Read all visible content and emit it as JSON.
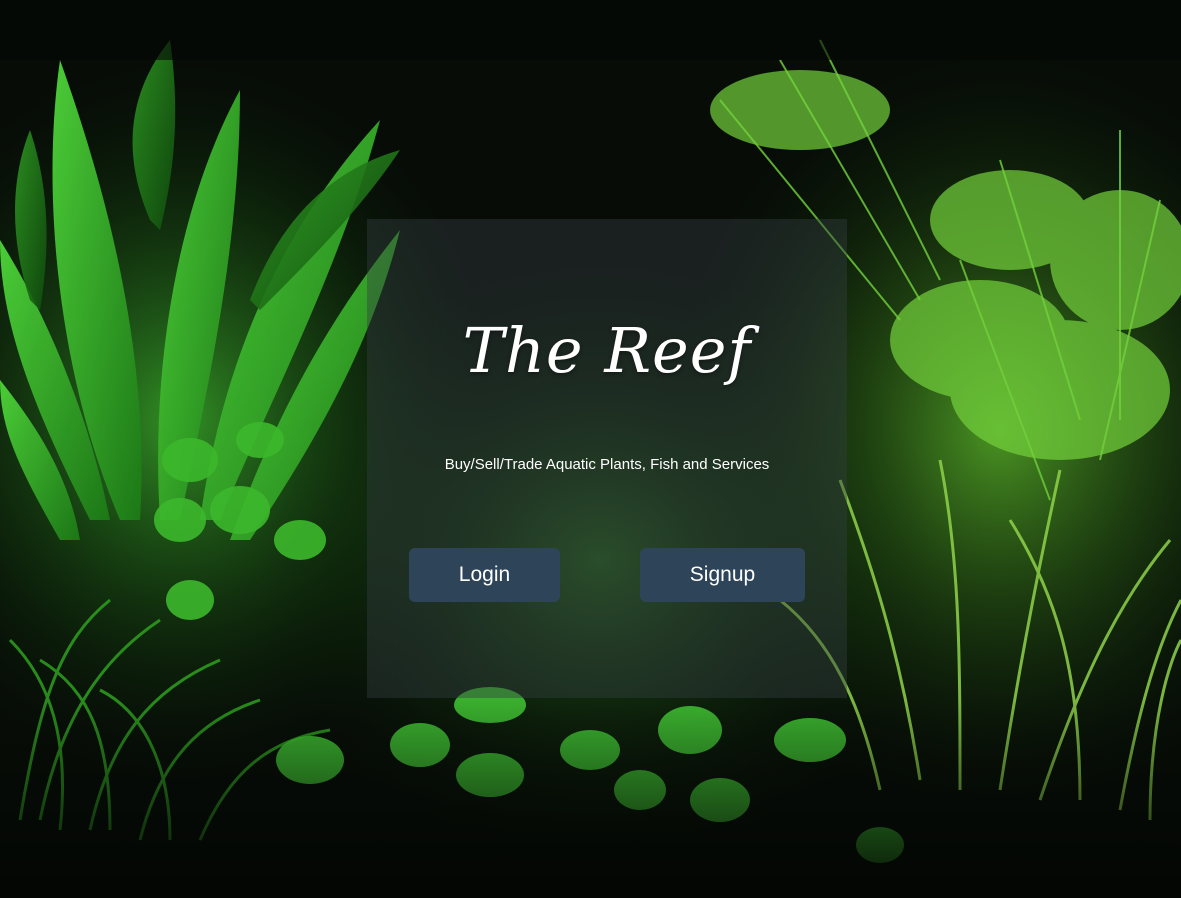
{
  "hero": {
    "title": "The Reef",
    "tagline": "Buy/Sell/Trade Aquatic Plants, Fish and Services"
  },
  "actions": {
    "login_label": "Login",
    "signup_label": "Signup"
  },
  "colors": {
    "button_bg": "#2e4559",
    "panel_bg": "rgba(52,62,66,0.42)",
    "text": "#ffffff"
  }
}
